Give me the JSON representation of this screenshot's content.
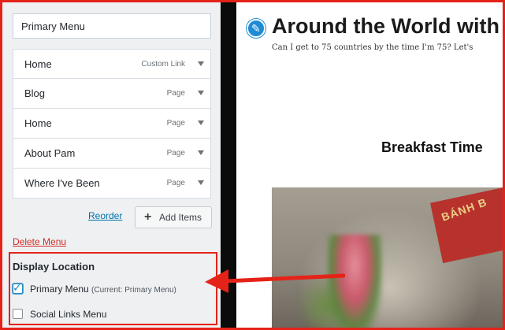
{
  "menu_name": {
    "value": "Primary Menu"
  },
  "menu_items": [
    {
      "title": "Home",
      "type": "Custom Link"
    },
    {
      "title": "Blog",
      "type": "Page"
    },
    {
      "title": "Home",
      "type": "Page"
    },
    {
      "title": "About Pam",
      "type": "Page"
    },
    {
      "title": "Where I've Been",
      "type": "Page"
    }
  ],
  "actions": {
    "reorder_label": "Reorder",
    "add_items_label": "Add Items",
    "delete_menu_label": "Delete Menu"
  },
  "display_location": {
    "title": "Display Location",
    "primary_label": "Primary Menu",
    "primary_note": "(Current: Primary Menu)",
    "primary_checked": true,
    "social_label": "Social Links Menu",
    "social_checked": false
  },
  "preview": {
    "site_title": "Around the World with",
    "tagline": "Can I get to 75 countries by the time I'm 75? Let's",
    "post_title": "Breakfast Time",
    "sign_text": "BÁNH B"
  },
  "colors": {
    "highlight_red": "#e52218",
    "link_blue": "#0073aa",
    "delete_red": "#d12c24",
    "edit_blue": "#1e8cd5"
  },
  "icons": {
    "edit": "pencil-icon",
    "add": "plus-icon",
    "expand": "triangle-down-icon",
    "checkbox": "check-icon"
  }
}
